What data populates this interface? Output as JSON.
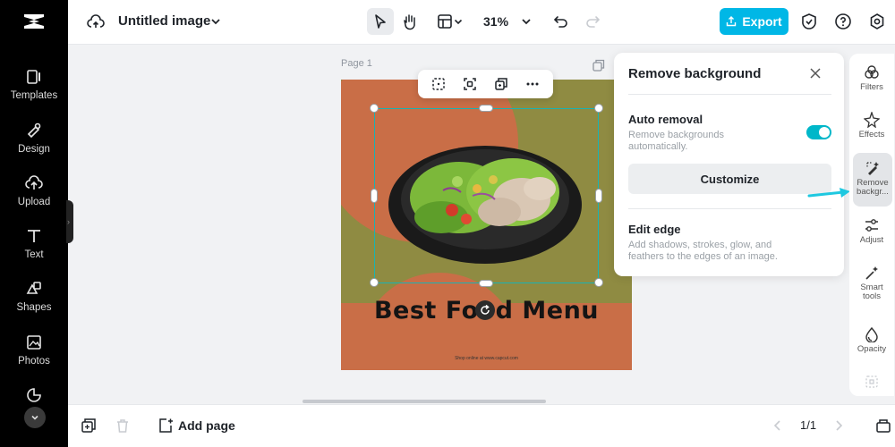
{
  "app": {
    "doc_title": "Untitled image",
    "zoom": "31%",
    "export_label": "Export",
    "accent_color": "#00b7e6"
  },
  "sidebar": {
    "items": [
      {
        "label": "Templates",
        "icon": "templates-icon"
      },
      {
        "label": "Design",
        "icon": "design-icon"
      },
      {
        "label": "Upload",
        "icon": "upload-icon"
      },
      {
        "label": "Text",
        "icon": "text-icon"
      },
      {
        "label": "Shapes",
        "icon": "shapes-icon"
      },
      {
        "label": "Photos",
        "icon": "photos-icon"
      }
    ]
  },
  "canvas": {
    "page_label": "Page 1",
    "headline": "Best Food Menu",
    "footer_text": "Shop online at www.capcut.com",
    "colors": {
      "background": "#8f8b42",
      "accent": "#c96e47"
    }
  },
  "bottom": {
    "add_page_label": "Add page",
    "page_indicator": "1/1"
  },
  "remove_bg_panel": {
    "title": "Remove background",
    "auto_removal": {
      "label": "Auto removal",
      "desc_line1": "Remove backgrounds",
      "desc_line2": "automatically.",
      "enabled": true
    },
    "customize_label": "Customize",
    "edit_edge": {
      "label": "Edit edge",
      "desc_line1": "Add shadows, strokes, glow, and",
      "desc_line2": "feathers to the edges of an image."
    }
  },
  "right_tools": {
    "filters": "Filters",
    "effects": "Effects",
    "remove_bg_line1": "Remove",
    "remove_bg_line2": "backgr...",
    "adjust": "Adjust",
    "smart_line1": "Smart",
    "smart_line2": "tools",
    "opacity": "Opacity"
  }
}
